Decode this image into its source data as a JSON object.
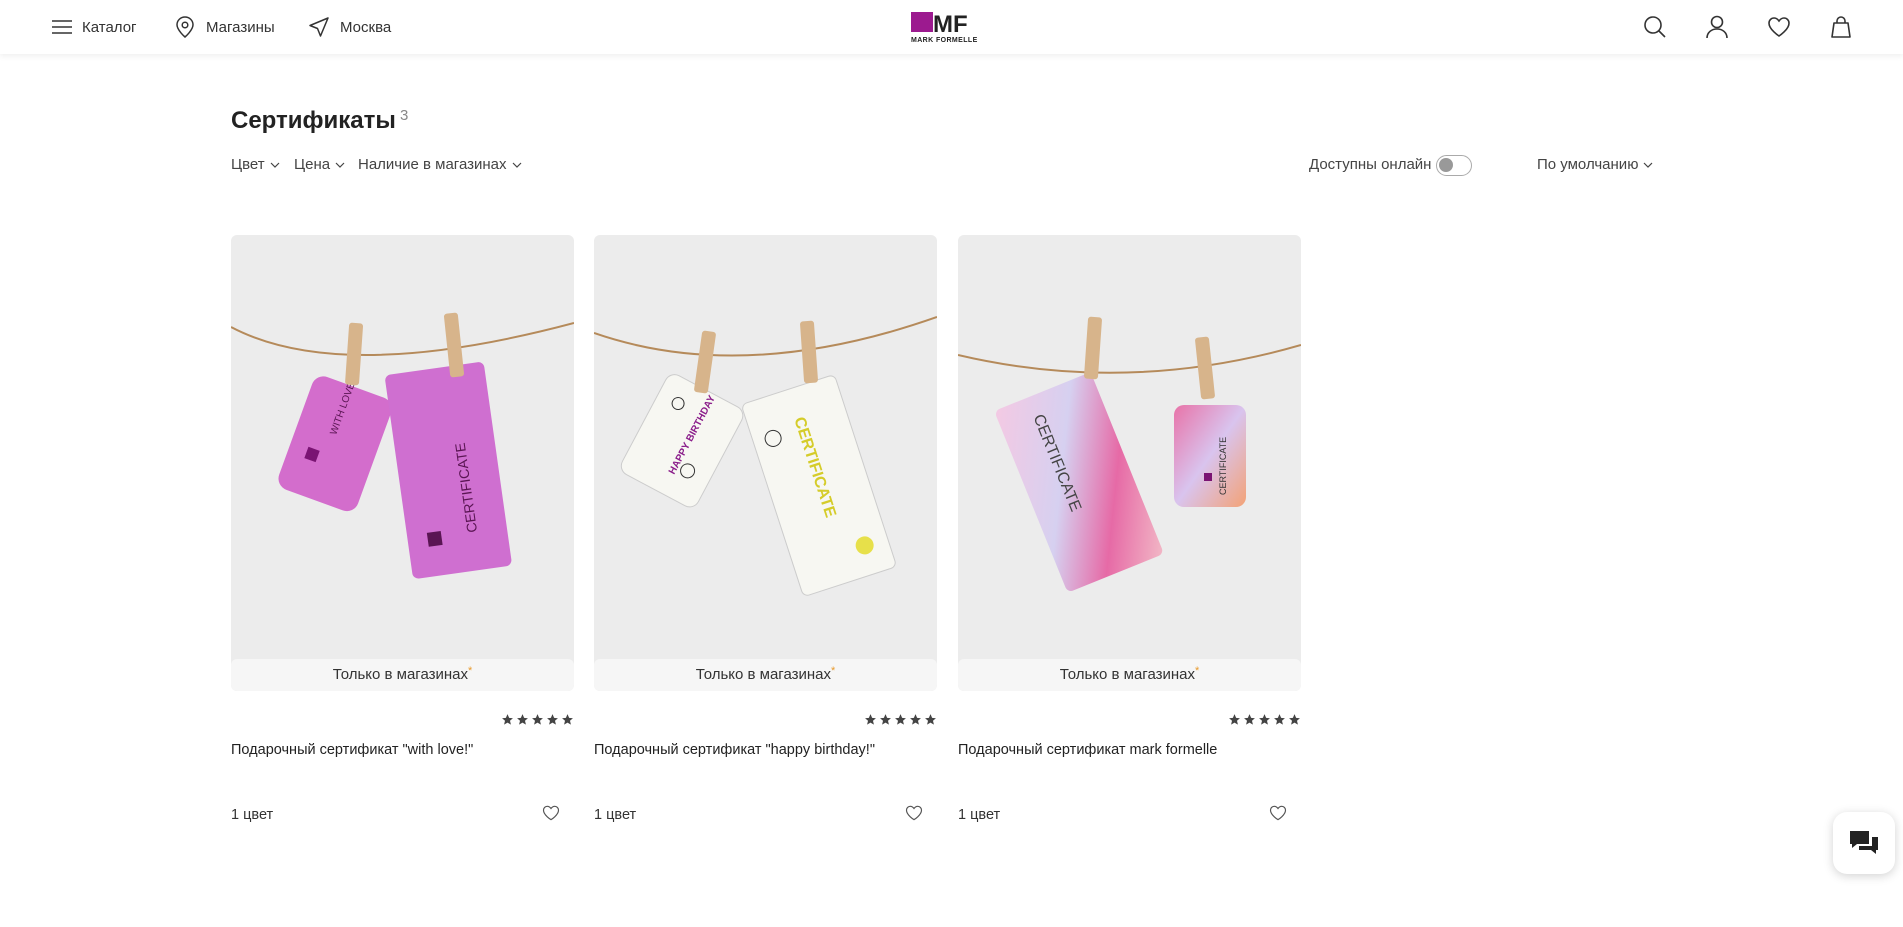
{
  "header": {
    "catalog": "Каталог",
    "stores": "Магазины",
    "city": "Москва",
    "logo_text": "MF",
    "logo_subtext": "MARK FORMELLE",
    "brand_color": "#9c1a8f"
  },
  "page": {
    "title": "Сертификаты",
    "count": "3"
  },
  "filters": {
    "color": "Цвет",
    "price": "Цена",
    "store_availability": "Наличие в магазинах",
    "online_label": "Доступны онлайн",
    "online_enabled": false,
    "sort": "По умолчанию"
  },
  "products": [
    {
      "badge": "Только в магазинах",
      "badge_mark": "*",
      "name": "Подарочный сертификат \"with love!\"",
      "colors": "1 цвет",
      "rating": 5,
      "card_texts": [
        "WITH LOVE",
        "CERTIFICATE"
      ]
    },
    {
      "badge": "Только в магазинах",
      "badge_mark": "*",
      "name": "Подарочный сертификат \"happy birthday!\"",
      "colors": "1 цвет",
      "rating": 5,
      "card_texts": [
        "HAPPY BIRTHDAY",
        "CERTIFICATE"
      ]
    },
    {
      "badge": "Только в магазинах",
      "badge_mark": "*",
      "name": "Подарочный сертификат mark formelle",
      "colors": "1 цвет",
      "rating": 5,
      "card_texts": [
        "CERTIFICATE",
        "CERTIFICATE"
      ]
    }
  ]
}
